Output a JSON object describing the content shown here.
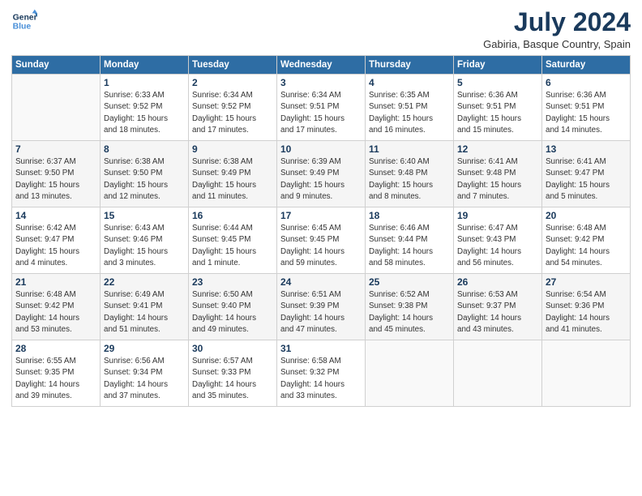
{
  "logo": {
    "line1": "General",
    "line2": "Blue"
  },
  "title": "July 2024",
  "location": "Gabiria, Basque Country, Spain",
  "days_of_week": [
    "Sunday",
    "Monday",
    "Tuesday",
    "Wednesday",
    "Thursday",
    "Friday",
    "Saturday"
  ],
  "weeks": [
    [
      {
        "day": "",
        "info": ""
      },
      {
        "day": "1",
        "info": "Sunrise: 6:33 AM\nSunset: 9:52 PM\nDaylight: 15 hours\nand 18 minutes."
      },
      {
        "day": "2",
        "info": "Sunrise: 6:34 AM\nSunset: 9:52 PM\nDaylight: 15 hours\nand 17 minutes."
      },
      {
        "day": "3",
        "info": "Sunrise: 6:34 AM\nSunset: 9:51 PM\nDaylight: 15 hours\nand 17 minutes."
      },
      {
        "day": "4",
        "info": "Sunrise: 6:35 AM\nSunset: 9:51 PM\nDaylight: 15 hours\nand 16 minutes."
      },
      {
        "day": "5",
        "info": "Sunrise: 6:36 AM\nSunset: 9:51 PM\nDaylight: 15 hours\nand 15 minutes."
      },
      {
        "day": "6",
        "info": "Sunrise: 6:36 AM\nSunset: 9:51 PM\nDaylight: 15 hours\nand 14 minutes."
      }
    ],
    [
      {
        "day": "7",
        "info": "Sunrise: 6:37 AM\nSunset: 9:50 PM\nDaylight: 15 hours\nand 13 minutes."
      },
      {
        "day": "8",
        "info": "Sunrise: 6:38 AM\nSunset: 9:50 PM\nDaylight: 15 hours\nand 12 minutes."
      },
      {
        "day": "9",
        "info": "Sunrise: 6:38 AM\nSunset: 9:49 PM\nDaylight: 15 hours\nand 11 minutes."
      },
      {
        "day": "10",
        "info": "Sunrise: 6:39 AM\nSunset: 9:49 PM\nDaylight: 15 hours\nand 9 minutes."
      },
      {
        "day": "11",
        "info": "Sunrise: 6:40 AM\nSunset: 9:48 PM\nDaylight: 15 hours\nand 8 minutes."
      },
      {
        "day": "12",
        "info": "Sunrise: 6:41 AM\nSunset: 9:48 PM\nDaylight: 15 hours\nand 7 minutes."
      },
      {
        "day": "13",
        "info": "Sunrise: 6:41 AM\nSunset: 9:47 PM\nDaylight: 15 hours\nand 5 minutes."
      }
    ],
    [
      {
        "day": "14",
        "info": "Sunrise: 6:42 AM\nSunset: 9:47 PM\nDaylight: 15 hours\nand 4 minutes."
      },
      {
        "day": "15",
        "info": "Sunrise: 6:43 AM\nSunset: 9:46 PM\nDaylight: 15 hours\nand 3 minutes."
      },
      {
        "day": "16",
        "info": "Sunrise: 6:44 AM\nSunset: 9:45 PM\nDaylight: 15 hours\nand 1 minute."
      },
      {
        "day": "17",
        "info": "Sunrise: 6:45 AM\nSunset: 9:45 PM\nDaylight: 14 hours\nand 59 minutes."
      },
      {
        "day": "18",
        "info": "Sunrise: 6:46 AM\nSunset: 9:44 PM\nDaylight: 14 hours\nand 58 minutes."
      },
      {
        "day": "19",
        "info": "Sunrise: 6:47 AM\nSunset: 9:43 PM\nDaylight: 14 hours\nand 56 minutes."
      },
      {
        "day": "20",
        "info": "Sunrise: 6:48 AM\nSunset: 9:42 PM\nDaylight: 14 hours\nand 54 minutes."
      }
    ],
    [
      {
        "day": "21",
        "info": "Sunrise: 6:48 AM\nSunset: 9:42 PM\nDaylight: 14 hours\nand 53 minutes."
      },
      {
        "day": "22",
        "info": "Sunrise: 6:49 AM\nSunset: 9:41 PM\nDaylight: 14 hours\nand 51 minutes."
      },
      {
        "day": "23",
        "info": "Sunrise: 6:50 AM\nSunset: 9:40 PM\nDaylight: 14 hours\nand 49 minutes."
      },
      {
        "day": "24",
        "info": "Sunrise: 6:51 AM\nSunset: 9:39 PM\nDaylight: 14 hours\nand 47 minutes."
      },
      {
        "day": "25",
        "info": "Sunrise: 6:52 AM\nSunset: 9:38 PM\nDaylight: 14 hours\nand 45 minutes."
      },
      {
        "day": "26",
        "info": "Sunrise: 6:53 AM\nSunset: 9:37 PM\nDaylight: 14 hours\nand 43 minutes."
      },
      {
        "day": "27",
        "info": "Sunrise: 6:54 AM\nSunset: 9:36 PM\nDaylight: 14 hours\nand 41 minutes."
      }
    ],
    [
      {
        "day": "28",
        "info": "Sunrise: 6:55 AM\nSunset: 9:35 PM\nDaylight: 14 hours\nand 39 minutes."
      },
      {
        "day": "29",
        "info": "Sunrise: 6:56 AM\nSunset: 9:34 PM\nDaylight: 14 hours\nand 37 minutes."
      },
      {
        "day": "30",
        "info": "Sunrise: 6:57 AM\nSunset: 9:33 PM\nDaylight: 14 hours\nand 35 minutes."
      },
      {
        "day": "31",
        "info": "Sunrise: 6:58 AM\nSunset: 9:32 PM\nDaylight: 14 hours\nand 33 minutes."
      },
      {
        "day": "",
        "info": ""
      },
      {
        "day": "",
        "info": ""
      },
      {
        "day": "",
        "info": ""
      }
    ]
  ]
}
